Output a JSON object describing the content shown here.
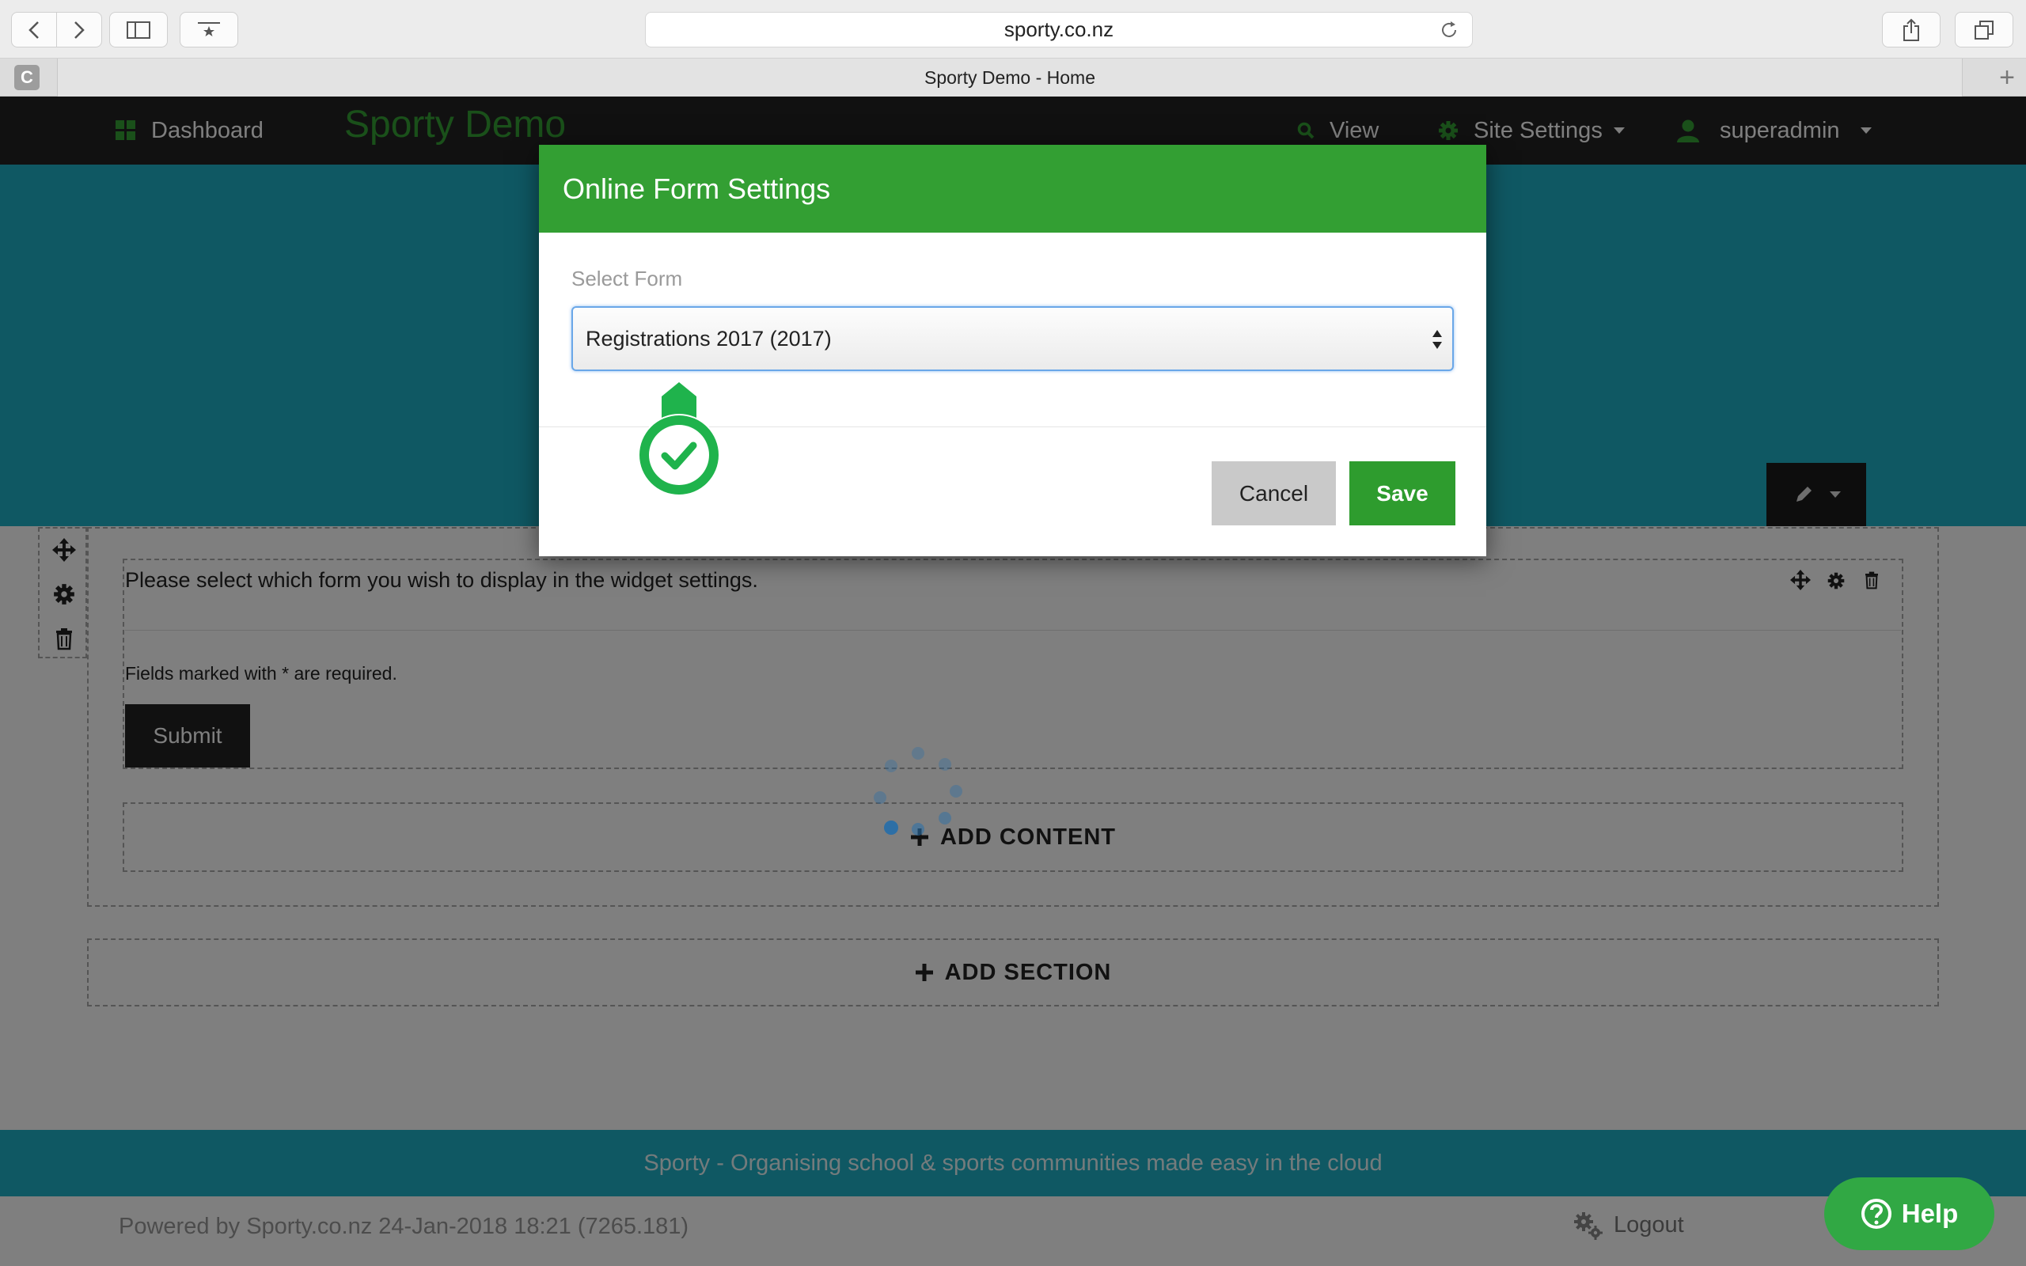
{
  "browser": {
    "url": "sporty.co.nz",
    "tab_favicon": "C",
    "tab_title": "Sporty Demo - Home"
  },
  "nav": {
    "dashboard": "Dashboard",
    "brand": "Sporty Demo",
    "view": "View",
    "site_settings": "Site Settings",
    "user": "superadmin"
  },
  "page": {
    "widget_message": "Please select which form you wish to display in the widget settings.",
    "required_note": "Fields marked with * are required.",
    "submit": "Submit",
    "add_content": "ADD CONTENT",
    "add_section": "ADD SECTION",
    "footer_tagline": "Sporty - Organising school & sports communities made easy in the cloud",
    "powered_by": "Powered by Sporty.co.nz 24-Jan-2018 18:21 (7265.181)",
    "logout": "Logout",
    "help": "Help"
  },
  "modal": {
    "title": "Online Form Settings",
    "select_label": "Select Form",
    "select_value": "Registrations 2017 (2017)",
    "cancel": "Cancel",
    "save": "Save"
  },
  "colors": {
    "brand_green": "#339f33",
    "hero_teal": "#1eb0c7",
    "nav_dark": "#222222"
  }
}
